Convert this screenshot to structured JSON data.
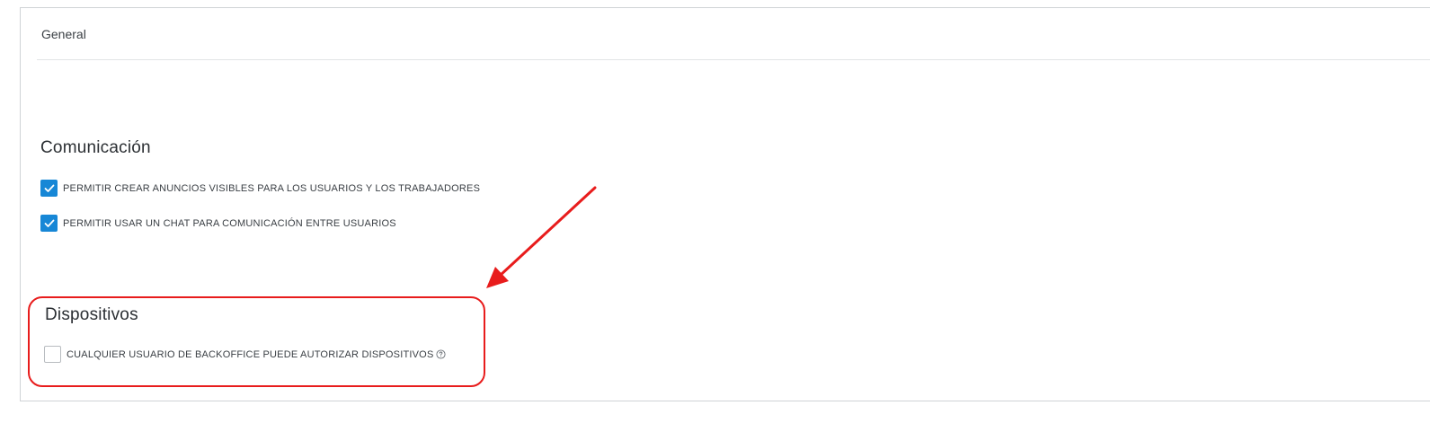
{
  "panel": {
    "header": "General"
  },
  "sections": {
    "communication": {
      "title": "Comunicación",
      "options": [
        {
          "label": "PERMITIR CREAR ANUNCIOS VISIBLES PARA LOS USUARIOS Y LOS TRABAJADORES",
          "checked": true
        },
        {
          "label": "PERMITIR USAR UN CHAT PARA COMUNICACIÓN ENTRE USUARIOS",
          "checked": true
        }
      ]
    },
    "devices": {
      "title": "Dispositivos",
      "options": [
        {
          "label": "CUALQUIER USUARIO DE BACKOFFICE PUEDE AUTORIZAR DISPOSITIVOS",
          "checked": false,
          "help_icon": "question-circle-icon"
        }
      ]
    }
  },
  "colors": {
    "accent": "#1787d6",
    "annotation": "#e81c1c"
  }
}
